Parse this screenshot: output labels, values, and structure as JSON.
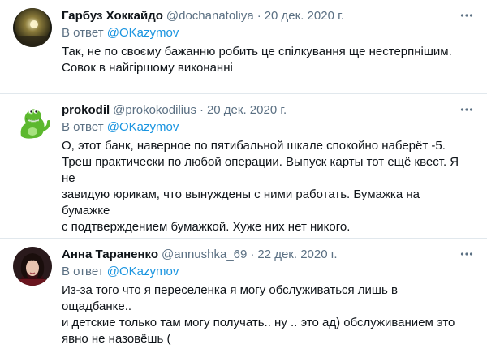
{
  "tweets": [
    {
      "author_name": "Гарбуз Хоккайдо",
      "handle": "@dochanatoliya",
      "separator": "·",
      "date": "20 дек. 2020 г.",
      "reply_prefix": "В ответ",
      "reply_mention": "@OKazymov",
      "text": "Так, не по своєму бажанню робить це спілкування ще нестерпнішим.\nСовок в найгіршому виконанні",
      "more_icon": "more-horizontal-icon"
    },
    {
      "author_name": "prokodil",
      "handle": "@prokokodilius",
      "separator": "·",
      "date": "20 дек. 2020 г.",
      "reply_prefix": "В ответ",
      "reply_mention": "@OKazymov",
      "text": "О, этот банк, наверное по пятибальной шкале спокойно наберёт -5.\nТреш практически по любой операции. Выпуск карты тот ещё квест. Я не\nзавидую юрикам, что вынуждены с ними работать. Бумажка на бумажке\nс подтверждением бумажкой. Хуже них нет никого.",
      "more_icon": "more-horizontal-icon"
    },
    {
      "author_name": "Анна Тараненко",
      "handle": "@annushka_69",
      "separator": "·",
      "date": "22 дек. 2020 г.",
      "reply_prefix": "В ответ",
      "reply_mention": "@OKazymov",
      "text": "Из-за того что я переселенка я могу обслуживаться лишь в ощадбанке..\nи детские только там могу получать.. ну .. это ад) обслуживанием это\nявно не назовёшь (",
      "more_icon": "more-horizontal-icon"
    }
  ],
  "colors": {
    "link": "#1b95e0",
    "muted": "#5b7083",
    "text": "#0f1419",
    "divider": "#e1e8ed"
  }
}
